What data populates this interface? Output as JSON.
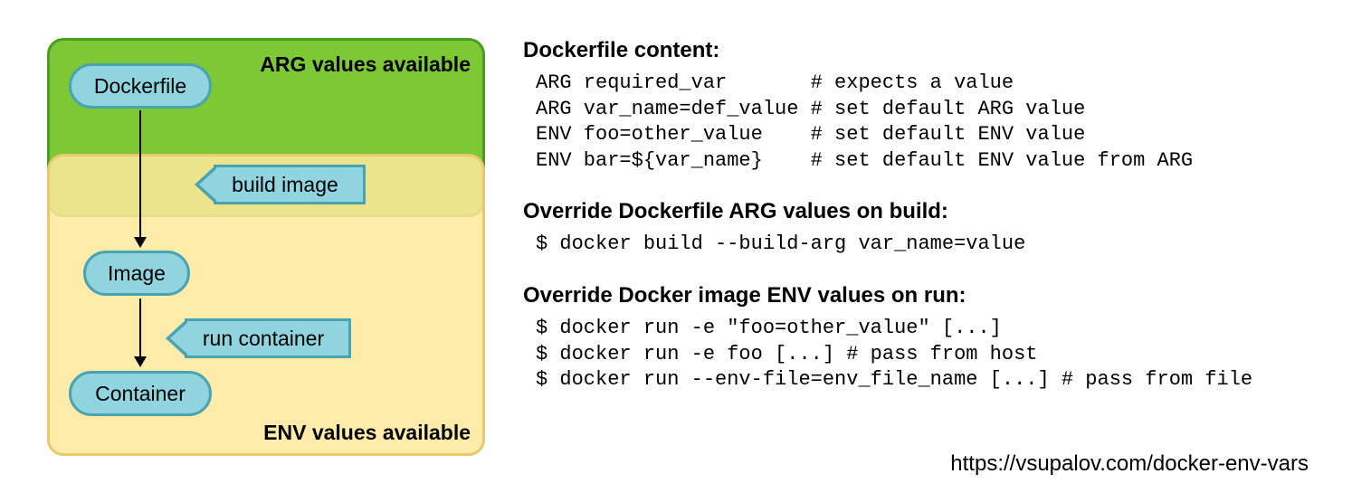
{
  "diagram": {
    "arg_box_label": "ARG values available",
    "env_box_label": "ENV values available",
    "pill_dockerfile": "Dockerfile",
    "pill_image": "Image",
    "pill_container": "Container",
    "tag_build": "build image",
    "tag_run": "run container"
  },
  "sections": {
    "s1_heading": "Dockerfile content:",
    "s1_code": "ARG required_var       # expects a value\nARG var_name=def_value # set default ARG value\nENV foo=other_value    # set default ENV value\nENV bar=${var_name}    # set default ENV value from ARG",
    "s2_heading": "Override Dockerfile ARG values on build:",
    "s2_code": "$ docker build --build-arg var_name=value",
    "s3_heading": "Override Docker image ENV values on run:",
    "s3_code": "$ docker run -e \"foo=other_value\" [...]\n$ docker run -e foo [...] # pass from host\n$ docker run --env-file=env_file_name [...] # pass from file"
  },
  "source": "https://vsupalov.com/docker-env-vars"
}
